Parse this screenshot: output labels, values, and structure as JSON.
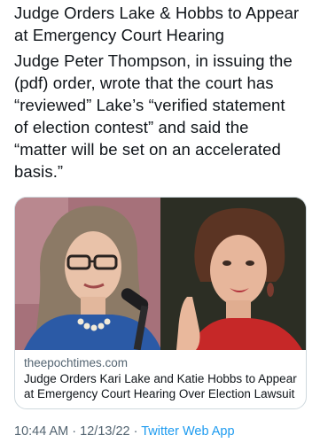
{
  "tweet": {
    "headline": "Judge Orders Lake & Hobbs to Appear at Emergency Court Hearing",
    "body_lines": [
      "Judge Peter Thompson, in issuing the",
      "(pdf) order, wrote that the court has",
      "“reviewed” Lake’s “verified statement",
      "of election contest” and said the",
      "“matter will be set on an accelerated",
      "basis.”"
    ],
    "headline_lines": [
      "Judge Orders Lake & Hobbs to Appear",
      "at Emergency Court Hearing"
    ]
  },
  "card": {
    "domain": "theepochtimes.com",
    "title_lines": [
      "Judge Orders Kari Lake and Katie Hobbs to Appear",
      "at Emergency Court Hearing Over Election Lawsuit"
    ],
    "left_photo_icon": "portrait-photo-icon",
    "right_photo_icon": "portrait-photo-icon"
  },
  "meta": {
    "time": "10:44 AM",
    "separator_1": " · ",
    "date": "12/13/22",
    "separator_2": " · ",
    "source": "Twitter Web App"
  },
  "colors": {
    "text": "#0f1419",
    "secondary": "#536471",
    "link": "#1d9bf0",
    "border": "#cfd9de"
  }
}
